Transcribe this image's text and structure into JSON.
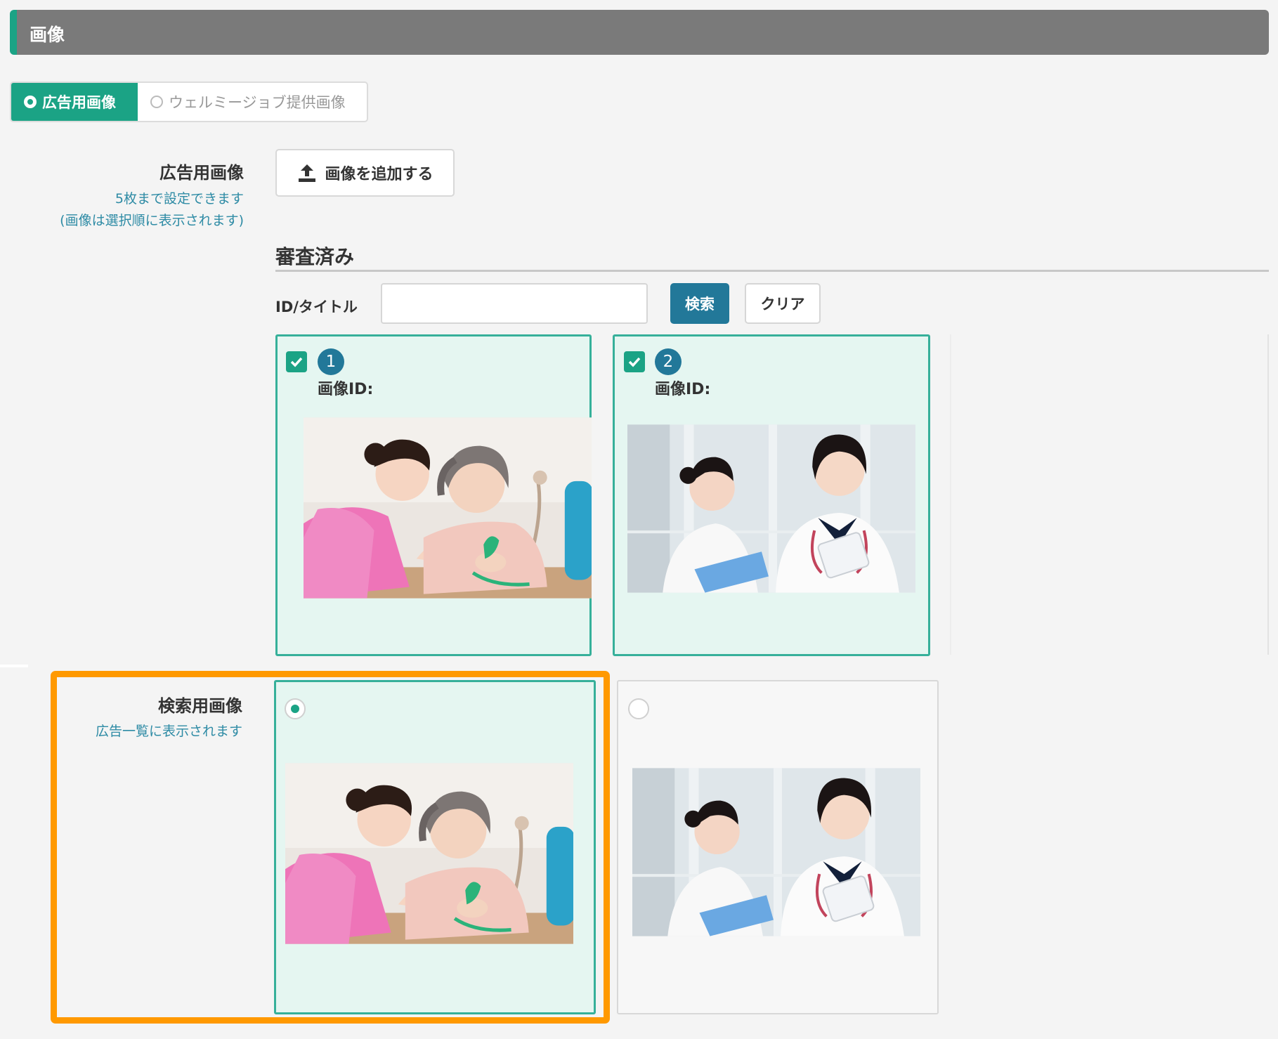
{
  "header": {
    "title": "画像"
  },
  "image_source_tabs": [
    {
      "label": "広告用画像",
      "selected": true
    },
    {
      "label": "ウェルミージョブ提供画像",
      "selected": false
    }
  ],
  "ad_images": {
    "label": "広告用画像",
    "note_line1": "5枚まで設定できます",
    "note_line2": "(画像は選択順に表示されます)",
    "add_button_label": "画像を追加する"
  },
  "reviewed": {
    "title": "審査済み",
    "search_label": "ID/タイトル",
    "search_value": "",
    "search_button_label": "検索",
    "clear_button_label": "クリア",
    "cards": [
      {
        "order": "1",
        "id_label": "画像ID:",
        "checked": true,
        "image": "caregiver-elderly-knitting-photo"
      },
      {
        "order": "2",
        "id_label": "画像ID:",
        "checked": true,
        "image": "two-nurses-clipboard-photo"
      }
    ]
  },
  "search_images": {
    "label": "検索用画像",
    "note": "広告一覧に表示されます",
    "options": [
      {
        "selected": true,
        "image": "caregiver-elderly-knitting-photo"
      },
      {
        "selected": false,
        "image": "two-nurses-clipboard-photo"
      }
    ]
  },
  "colors": {
    "brand_green": "#1ba385",
    "brand_blue": "#227899",
    "header_gray": "#7a7a7a",
    "highlight_orange": "#ff9900",
    "selected_card_bg": "#e5f6f1"
  }
}
